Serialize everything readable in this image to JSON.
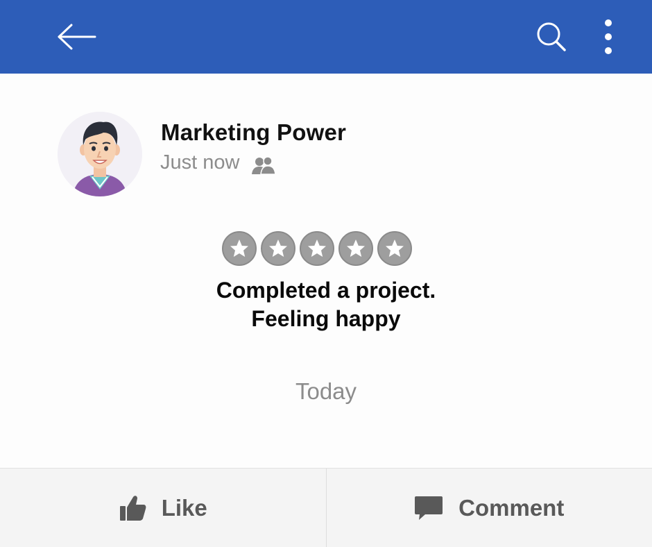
{
  "topbar": {
    "back_icon": "arrow-left-icon",
    "search_icon": "search-icon",
    "more_icon": "more-vertical-icon",
    "color": "#2d5db8"
  },
  "post": {
    "author": "Marketing Power",
    "timestamp": "Just now",
    "audience_icon": "friends-icon",
    "rating": {
      "stars_total": 5,
      "stars_filled": 0
    },
    "text_line1": "Completed a project.",
    "text_line2": "Feeling happy",
    "date": "Today"
  },
  "actions": {
    "like_label": "Like",
    "like_icon": "thumbs-up-icon",
    "comment_label": "Comment",
    "comment_icon": "comment-icon"
  }
}
